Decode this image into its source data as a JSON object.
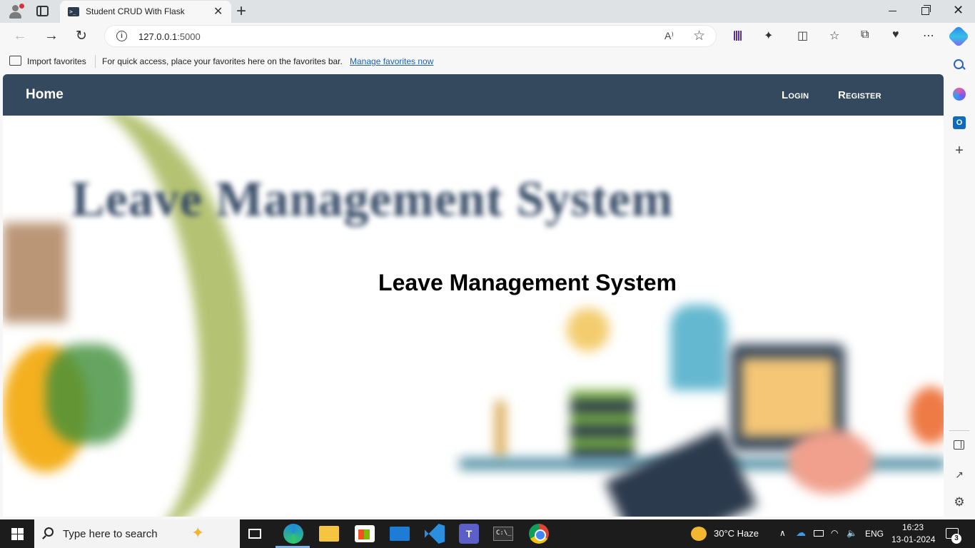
{
  "browser": {
    "tab_title": "Student CRUD With Flask",
    "tab_favicon": ">_",
    "url_host": "127.0.0.1",
    "url_port": ":5000",
    "read_aloud": "A⁾",
    "new_tab": "+",
    "close_tab": "✕",
    "window_close": "✕"
  },
  "favorites_bar": {
    "import_label": "Import favorites",
    "hint": "For quick access, place your favorites here on the favorites bar.",
    "manage_link": "Manage favorites now"
  },
  "site_nav": {
    "home": "Home",
    "login": "Login",
    "register": "Register"
  },
  "hero": {
    "background_text": "Leave Management System",
    "title": "Leave Management System"
  },
  "sidebar": {
    "outlook_letter": "O",
    "add": "+",
    "popout": "↗",
    "gear": "⚙"
  },
  "taskbar": {
    "search_placeholder": "Type here to search",
    "search_spark": "✦",
    "teams_letter": "T",
    "terminal_text": "C:\\_",
    "weather": "30°C  Haze",
    "language": "ENG",
    "time": "16:23",
    "date": "13-01-2024",
    "notifications_count": "3",
    "tray_up": "∧",
    "tray_cloud": "☁",
    "tray_wifi": "◠",
    "tray_volume": "🔈"
  },
  "colors": {
    "navbar_bg": "#34495e",
    "link": "#1a62b7"
  }
}
